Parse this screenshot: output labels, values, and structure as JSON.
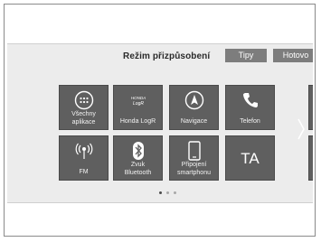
{
  "header": {
    "title": "Režim přizpůsobení",
    "tips_label": "Tipy",
    "done_label": "Hotovo"
  },
  "tiles": [
    {
      "label_line1": "Všechny",
      "label_line2": "aplikace",
      "icon": "apps-grid-icon"
    },
    {
      "label_line1": "Honda LogR",
      "label_line2": "",
      "icon": "honda-logr-icon"
    },
    {
      "label_line1": "Navigace",
      "label_line2": "",
      "icon": "navigation-icon"
    },
    {
      "label_line1": "Telefon",
      "label_line2": "",
      "icon": "phone-icon"
    },
    {
      "label_line1": "FM",
      "label_line2": "",
      "icon": "radio-antenna-icon"
    },
    {
      "label_line1": "Zvuk",
      "label_line2": "Bluetooth",
      "icon": "bluetooth-icon"
    },
    {
      "label_line1": "Připojení",
      "label_line2": "smartphonu",
      "icon": "smartphone-icon"
    },
    {
      "label_line1": "TA",
      "label_line2": "",
      "icon": "traffic-announcement-text"
    }
  ],
  "pagination": {
    "pages": 3,
    "current": 1
  },
  "colors": {
    "tile": "#5f5f5f",
    "header_button": "#7d7d7d",
    "screen_bg": "#ececec"
  }
}
